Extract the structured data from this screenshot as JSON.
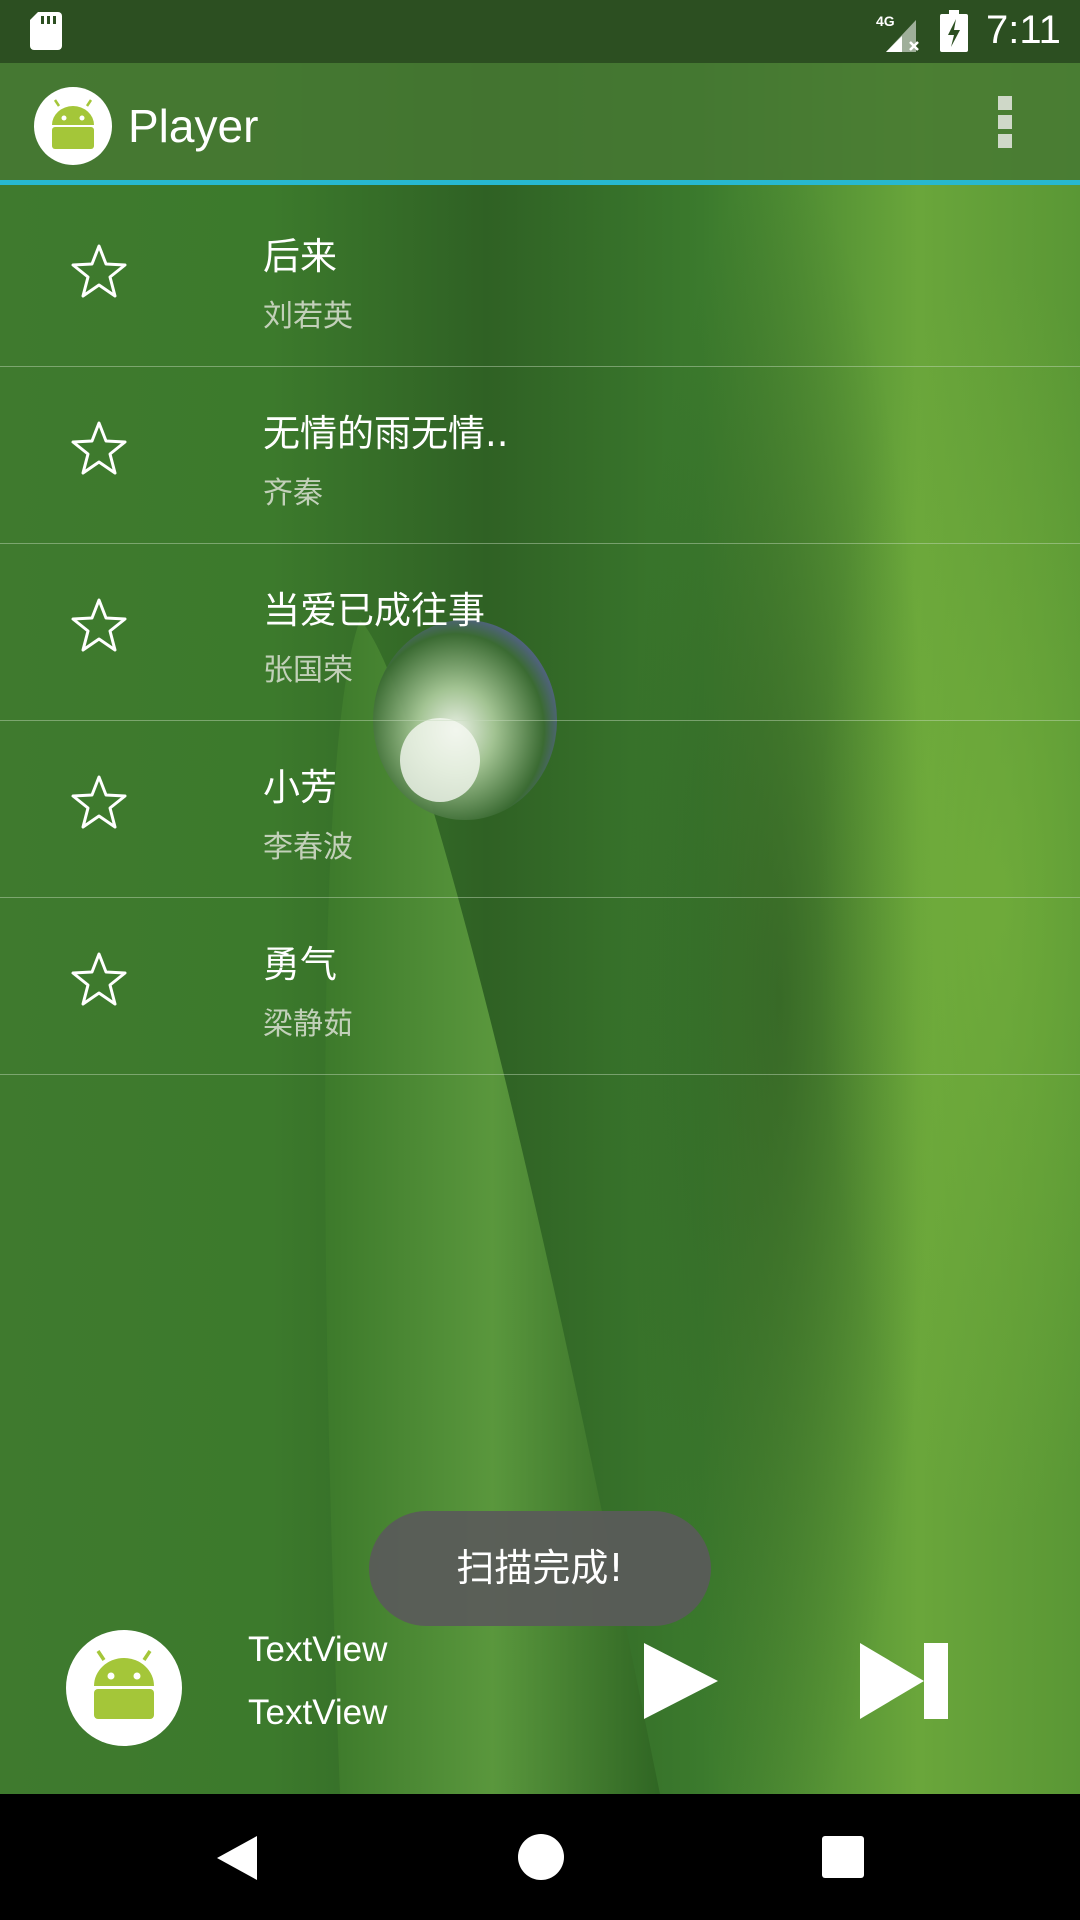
{
  "status_bar": {
    "time": "7:11",
    "network": "4G",
    "icons": [
      "sd-card-icon",
      "signal-4g-icon",
      "battery-charging-icon"
    ]
  },
  "app_bar": {
    "title": "Player",
    "logo_icon": "android-icon",
    "menu_icon": "overflow-menu-icon",
    "accent_color": "#27b8d0"
  },
  "songs": [
    {
      "title": "后来",
      "artist": "刘若英"
    },
    {
      "title": "无情的雨无情..",
      "artist": "齐秦"
    },
    {
      "title": "当爱已成往事",
      "artist": "张国荣"
    },
    {
      "title": "小芳",
      "artist": "李春波"
    },
    {
      "title": "勇气",
      "artist": "梁静茹"
    }
  ],
  "toast": {
    "message": "扫描完成!"
  },
  "player": {
    "line1": "TextView",
    "line2": "TextView",
    "album_icon": "android-icon",
    "play_icon": "play-icon",
    "next_icon": "skip-next-icon"
  },
  "nav_bar": {
    "icons": [
      "back-icon",
      "home-icon",
      "recents-icon"
    ]
  }
}
